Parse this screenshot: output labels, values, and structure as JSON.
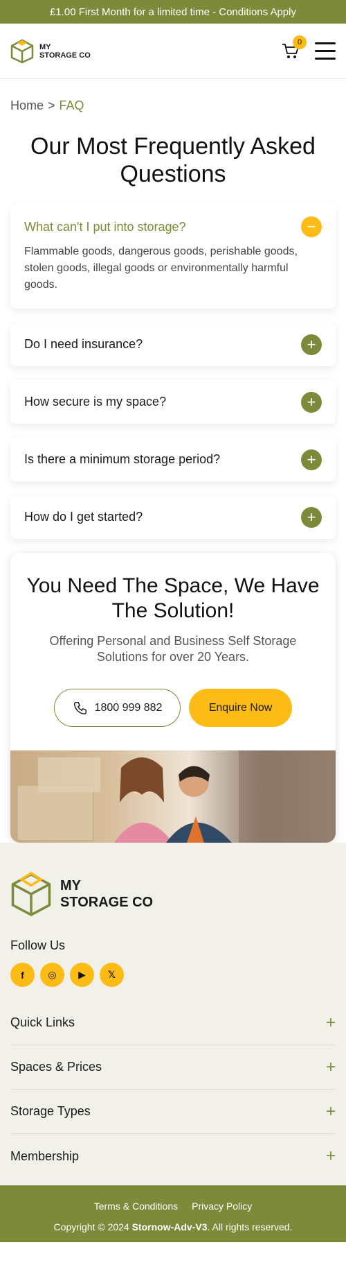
{
  "promo": {
    "text": "£1.00 First Month for a limited time - Conditions Apply"
  },
  "header": {
    "logo_line1": "MY",
    "logo_line2": "STORAGE CO",
    "cart_count": "0"
  },
  "breadcrumb": {
    "home": "Home",
    "separator": ">",
    "current": "FAQ"
  },
  "page_title": "Our Most Frequently Asked Questions",
  "faq": [
    {
      "question": "What can't I put into storage?",
      "answer": "Flammable goods, dangerous goods, perishable goods, stolen goods, illegal goods or environmentally harmful goods.",
      "open": true,
      "toggle": "−"
    },
    {
      "question": "Do I need insurance?",
      "open": false,
      "toggle": "+"
    },
    {
      "question": "How secure is my space?",
      "open": false,
      "toggle": "+"
    },
    {
      "question": "Is there a minimum storage period?",
      "open": false,
      "toggle": "+"
    },
    {
      "question": "How do I get started?",
      "open": false,
      "toggle": "+"
    }
  ],
  "cta": {
    "title": "You Need The Space, We Have The Solution!",
    "subtitle": "Offering Personal and Business Self Storage Solutions for over 20 Years.",
    "phone": "1800 999 882",
    "enquire": "Enquire Now"
  },
  "footer": {
    "logo_line1": "MY",
    "logo_line2": "STORAGE CO",
    "follow_title": "Follow Us",
    "socials": [
      {
        "icon": "facebook-icon",
        "glyph": "f"
      },
      {
        "icon": "instagram-icon",
        "glyph": "◎"
      },
      {
        "icon": "youtube-icon",
        "glyph": "▶"
      },
      {
        "icon": "x-icon",
        "glyph": "𝕏"
      }
    ],
    "sections": [
      "Quick Links",
      "Spaces & Prices",
      "Storage Types",
      "Membership"
    ],
    "expand_glyph": "+",
    "links": [
      "Terms & Conditions",
      "Privacy Policy"
    ],
    "copyright_prefix": "Copyright © 2024",
    "copyright_brand": "Stornow-Adv-V3",
    "copyright_suffix": ". All rights reserved."
  },
  "colors": {
    "brand_olive": "#7d8a3a",
    "accent_yellow": "#fdbb16"
  }
}
